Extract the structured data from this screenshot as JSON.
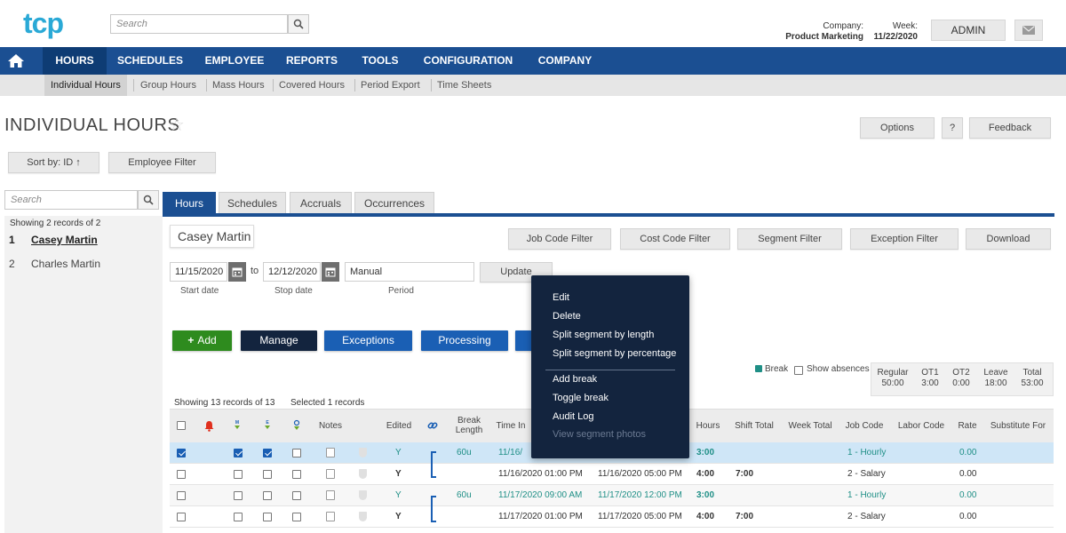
{
  "header": {
    "logo": "tcp",
    "search_placeholder": "Search",
    "company_label": "Company:",
    "company_value": "Product Marketing",
    "week_label": "Week:",
    "week_value": "11/22/2020",
    "admin_label": "ADMIN"
  },
  "nav": {
    "items": [
      "HOURS",
      "SCHEDULES",
      "EMPLOYEE",
      "REPORTS",
      "TOOLS",
      "CONFIGURATION",
      "COMPANY"
    ],
    "active": "HOURS"
  },
  "subnav": {
    "items": [
      "Individual Hours",
      "Group Hours",
      "Mass Hours",
      "Covered Hours",
      "Period Export",
      "Time Sheets"
    ],
    "active": "Individual Hours"
  },
  "page": {
    "title": "INDIVIDUAL HOURS",
    "options_label": "Options",
    "help_label": "?",
    "feedback_label": "Feedback",
    "sort_label": "Sort by: ID ↑",
    "employee_filter_label": "Employee Filter"
  },
  "left": {
    "search_placeholder": "Search",
    "count_text": "Showing 2 records of 2",
    "employees": [
      {
        "num": "1",
        "name": "Casey Martin"
      },
      {
        "num": "2",
        "name": "Charles Martin"
      }
    ]
  },
  "tabs": [
    "Hours",
    "Schedules",
    "Accruals",
    "Occurrences"
  ],
  "employee_name": "Casey Martin",
  "filters": [
    "Job Code Filter",
    "Cost Code Filter",
    "Segment Filter",
    "Exception Filter",
    "Download"
  ],
  "dates": {
    "start": "11/15/2020",
    "to": "to",
    "stop": "12/12/2020",
    "period": "Manual",
    "update_label": "Update",
    "start_label": "Start date",
    "stop_label": "Stop date",
    "period_label": "Period"
  },
  "actions": {
    "add": "Add",
    "manage": "Manage",
    "exceptions": "Exceptions",
    "processing": "Processing"
  },
  "legend": {
    "break": "Break",
    "show_absences": "Show absences"
  },
  "summary": [
    {
      "label": "Regular",
      "value": "50:00"
    },
    {
      "label": "OT1",
      "value": "3:00"
    },
    {
      "label": "OT2",
      "value": "0:00"
    },
    {
      "label": "Leave",
      "value": "18:00"
    },
    {
      "label": "Total",
      "value": "53:00"
    }
  ],
  "table": {
    "showing_text": "Showing 13 records of 13",
    "selected_text": "Selected 1 records",
    "headers": {
      "notes": "Notes",
      "edited": "Edited",
      "break_length": "Break Length",
      "time_in": "Time In",
      "hours": "Hours",
      "shift_total": "Shift Total",
      "week_total": "Week Total",
      "job_code": "Job Code",
      "labor_code": "Labor Code",
      "rate": "Rate",
      "substitute_for": "Substitute For"
    },
    "rows": [
      {
        "edited": "Y",
        "break": "60u",
        "time_in": "11/16/",
        "time_out": "",
        "hours": "3:00",
        "shift_total": "",
        "job_code": "1 - Hourly",
        "rate": "0.00"
      },
      {
        "edited": "Y",
        "break": "",
        "time_in": "11/16/2020 01:00 PM",
        "time_out": "11/16/2020 05:00 PM",
        "hours": "4:00",
        "shift_total": "7:00",
        "job_code": "2 - Salary",
        "rate": "0.00"
      },
      {
        "edited": "Y",
        "break": "60u",
        "time_in": "11/17/2020 09:00 AM",
        "time_out": "11/17/2020 12:00 PM",
        "hours": "3:00",
        "shift_total": "",
        "job_code": "1 - Hourly",
        "rate": "0.00"
      },
      {
        "edited": "Y",
        "break": "",
        "time_in": "11/17/2020 01:00 PM",
        "time_out": "11/17/2020 05:00 PM",
        "hours": "4:00",
        "shift_total": "7:00",
        "job_code": "2 - Salary",
        "rate": "0.00"
      }
    ]
  },
  "context_menu": {
    "items": [
      "Edit",
      "Delete",
      "Split segment by length",
      "Split segment by percentage"
    ],
    "items2": [
      "Add break",
      "Toggle break",
      "Audit Log"
    ],
    "disabled_item": "View segment photos"
  },
  "colors": {
    "nav_blue": "#1b4f92",
    "accent_teal": "#1f8f86",
    "add_green": "#2e8b1e",
    "manage_dark": "#13243e",
    "exceptions_blue": "#1a5fb4",
    "menu_bg": "#13243e"
  }
}
